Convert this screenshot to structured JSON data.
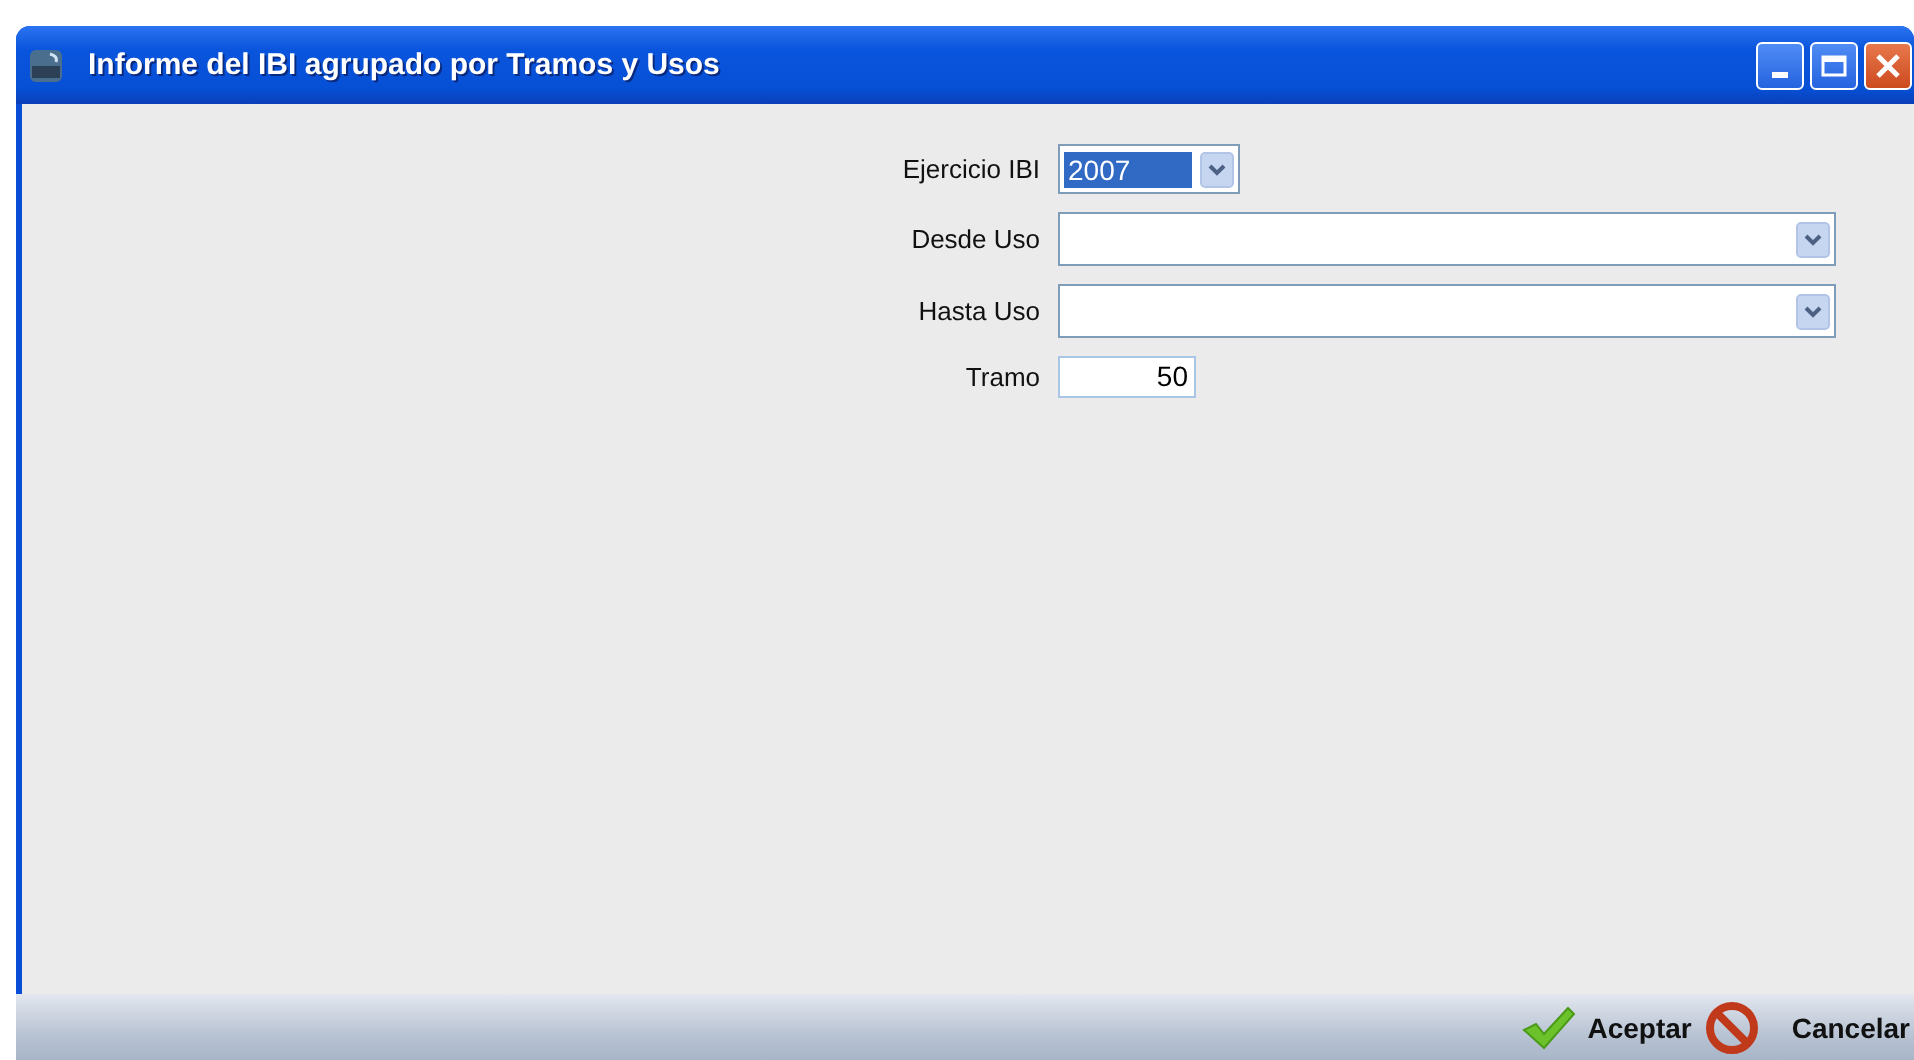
{
  "window": {
    "title": "Informe del IBI agrupado por Tramos y Usos"
  },
  "form": {
    "fields": [
      {
        "kind": "year_combo",
        "label": "Ejercicio IBI",
        "value": "2007"
      },
      {
        "kind": "combo",
        "label": "Desde Uso"
      },
      {
        "kind": "combo",
        "label": "Hasta Uso"
      },
      {
        "kind": "number",
        "label": "Tramo",
        "value": "50"
      }
    ]
  },
  "buttons": [
    {
      "kind": "accept",
      "label": "Aceptar"
    },
    {
      "kind": "cancel",
      "label": "Cancelar"
    }
  ]
}
